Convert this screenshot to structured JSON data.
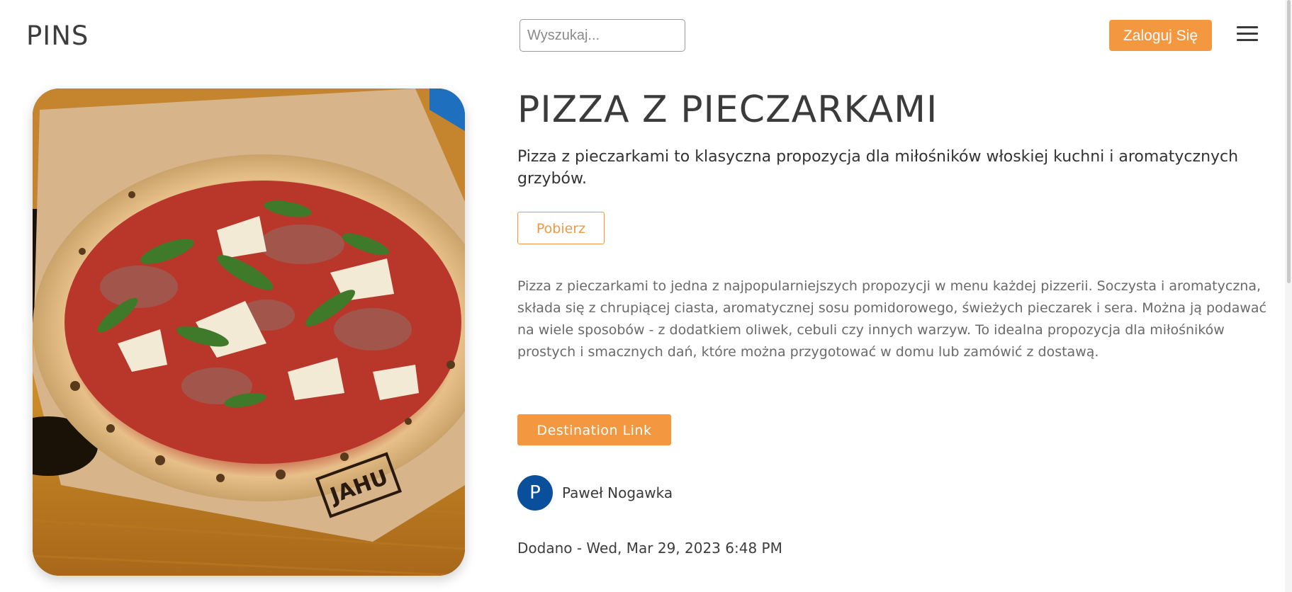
{
  "header": {
    "logo": "PINS",
    "search_placeholder": "Wyszukaj...",
    "login_label": "Zaloguj Się",
    "menu_icon": "hamburger-menu-icon"
  },
  "pin": {
    "image_alt": "Pizza z pieczarkami",
    "image_board_text": "JAHU",
    "title": "PIZZA Z PIECZARKAMI",
    "subtitle": "Pizza z pieczarkami to klasyczna propozycja dla miłośników włoskiej kuchni i aromatycznych grzybów.",
    "download_label": "Pobierz",
    "description": "Pizza z pieczarkami to jedna z najpopularniejszych propozycji w menu każdej pizzerii. Soczysta i aromatyczna, składa się z chrupiącej ciasta, aromatycznej sosu pomidorowego, świeżych pieczarek i sera. Można ją podawać na wiele sposobów - z dodatkiem oliwek, cebuli czy innych warzyw. To idealna propozycja dla miłośników prostych i smacznych dań, które można przygotować w domu lub zamówić z dostawą.",
    "destination_label": "Destination Link",
    "author": {
      "initial": "P",
      "name": "Paweł Nogawka"
    },
    "added": "Dodano - Wed, Mar 29, 2023 6:48 PM"
  },
  "colors": {
    "accent": "#f39840",
    "avatar": "#0a4f9c",
    "text": "#3a3a3a",
    "muted": "#6a6a6a"
  }
}
